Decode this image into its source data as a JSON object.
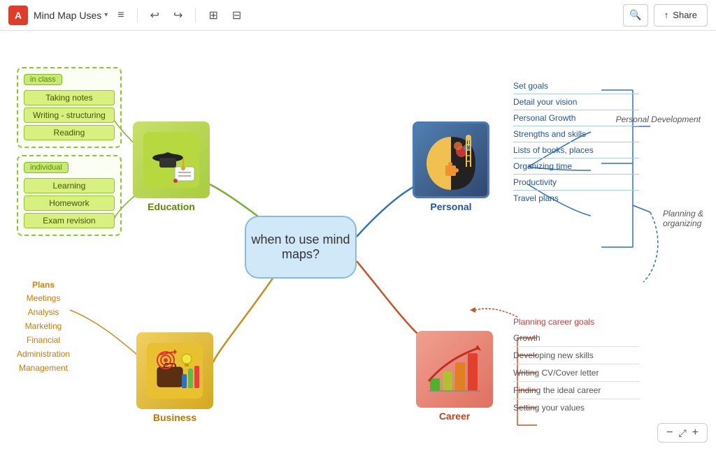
{
  "toolbar": {
    "logo": "A",
    "doc_title": "Mind Map Uses",
    "undo_icon": "↩",
    "redo_icon": "↪",
    "insert_icon": "⊞",
    "layout_icon": "⊟",
    "menu_icon": "≡",
    "search_icon": "🔍",
    "share_icon": "⬆",
    "share_label": "Share"
  },
  "center": {
    "text": "when to use mind maps?"
  },
  "education": {
    "label": "Education",
    "in_class_label": "in class",
    "in_class_items": [
      "Taking notes",
      "Writing - structuring",
      "Reading"
    ],
    "individual_label": "individual",
    "individual_items": [
      "Learning",
      "Homework",
      "Exam revision"
    ]
  },
  "business": {
    "label": "Business",
    "header": "Plans",
    "items": [
      "Meetings",
      "Analysis",
      "Marketing",
      "Financial",
      "Administration",
      "Management"
    ]
  },
  "personal": {
    "label": "Personal",
    "items": [
      "Set goals",
      "Detail your vision",
      "Personal Growth",
      "Strengths and skills",
      "Lists of books, places",
      "Organizing time",
      "Productivity",
      "Travel plans"
    ],
    "bracket1_label": "Personal\nDevelopment",
    "bracket2_label": "Planning &\norganizing"
  },
  "career": {
    "label": "Career",
    "header": "Planning career goals",
    "items": [
      "Growth",
      "Developing new skills",
      "Writing CV/Cover letter",
      "Finding the ideal career",
      "Setting  your values"
    ]
  },
  "zoom": {
    "minus": "−",
    "fit": "⤢",
    "plus": "+"
  }
}
